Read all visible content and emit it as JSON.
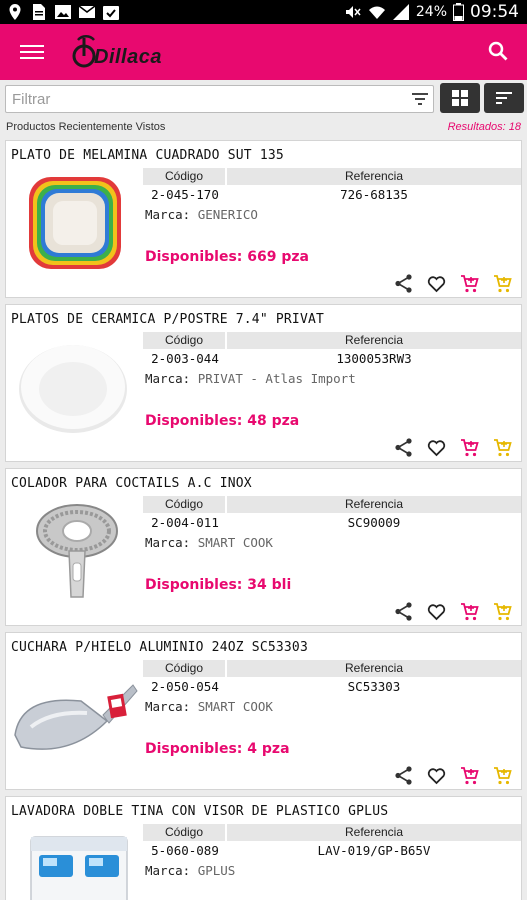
{
  "status_bar": {
    "battery_percent": "24%",
    "time": "09:54"
  },
  "app_bar": {
    "brand": "Dillaca",
    "menu_icon": "hamburger-menu-icon",
    "search_icon": "search-icon",
    "accent_color": "#e8096f"
  },
  "filter": {
    "placeholder": "Filtrar"
  },
  "list_header": {
    "recent_label": "Productos Recientemente Vistos",
    "results_label": "Resultados: 18"
  },
  "columns": {
    "code": "Código",
    "reference": "Referencia",
    "brand_label": "Marca:"
  },
  "products": [
    {
      "title": "PLATO DE MELAMINA CUADRADO SUT 135",
      "code": "2-045-170",
      "reference": "726-68135",
      "brand": "GENERICO",
      "available": "Disponibles: 669 pza",
      "image": "square-melamine-plate"
    },
    {
      "title": "PLATOS DE CERAMICA P/POSTRE 7.4\" PRIVAT",
      "code": "2-003-044",
      "reference": "1300053RW3",
      "brand": "PRIVAT - Atlas Import",
      "available": "Disponibles: 48 pza",
      "image": "white-ceramic-plate"
    },
    {
      "title": "COLADOR PARA COCTAILS A.C INOX",
      "code": "2-004-011",
      "reference": "SC90009",
      "brand": "SMART COOK",
      "available": "Disponibles: 34 bli",
      "image": "cocktail-strainer"
    },
    {
      "title": "CUCHARA P/HIELO ALUMINIO 24OZ SC53303",
      "code": "2-050-054",
      "reference": "SC53303",
      "brand": "SMART COOK",
      "available": "Disponibles: 4 pza",
      "image": "aluminum-ice-scoop"
    },
    {
      "title": "LAVADORA DOBLE TINA CON VISOR DE PLASTICO GPLUS",
      "code": "5-060-089",
      "reference": "LAV-019/GP-B65V",
      "brand": "GPLUS",
      "available": "",
      "image": "twin-tub-washer"
    }
  ]
}
